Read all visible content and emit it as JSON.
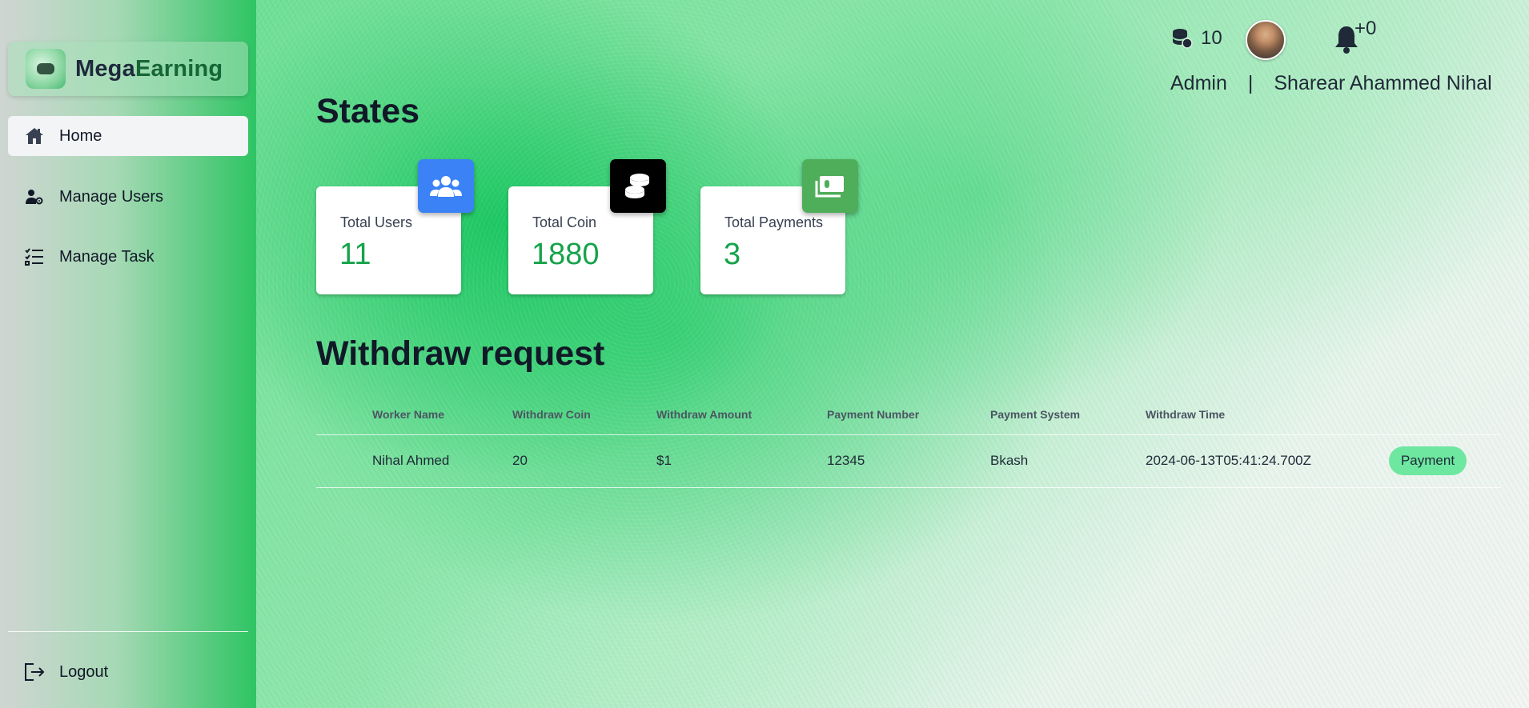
{
  "brand": {
    "part1": "Mega",
    "part2": "Earning"
  },
  "sidebar": {
    "items": [
      {
        "label": "Home",
        "icon": "home-icon",
        "active": true
      },
      {
        "label": "Manage Users",
        "icon": "user-gear-icon",
        "active": false
      },
      {
        "label": "Manage Task",
        "icon": "task-list-icon",
        "active": false
      }
    ],
    "logout": {
      "label": "Logout",
      "icon": "logout-icon"
    }
  },
  "header": {
    "coins": "10",
    "notifications": "+0",
    "role": "Admin",
    "separator": "|",
    "user_name": "Sharear Ahammed Nihal"
  },
  "states": {
    "title": "States",
    "cards": [
      {
        "label": "Total Users",
        "value": "11",
        "icon": "users-icon",
        "color": "#3b82f6"
      },
      {
        "label": "Total Coin",
        "value": "1880",
        "icon": "coins-icon",
        "color": "#000000"
      },
      {
        "label": "Total Payments",
        "value": "3",
        "icon": "money-icon",
        "color": "#4fae5a"
      }
    ]
  },
  "withdraw": {
    "title": "Withdraw request",
    "columns": [
      "Worker Name",
      "Withdraw Coin",
      "Withdraw Amount",
      "Payment Number",
      "Payment System",
      "Withdraw Time"
    ],
    "rows": [
      {
        "worker_name": "Nihal Ahmed",
        "coin": "20",
        "amount": "$1",
        "number": "12345",
        "system": "Bkash",
        "time": "2024-06-13T05:41:24.700Z",
        "action": "Payment"
      }
    ]
  },
  "colors": {
    "accent_green": "#16a34a",
    "payment_button": "#6ee7a0",
    "sidebar_gradient_end": "#2ec463"
  }
}
